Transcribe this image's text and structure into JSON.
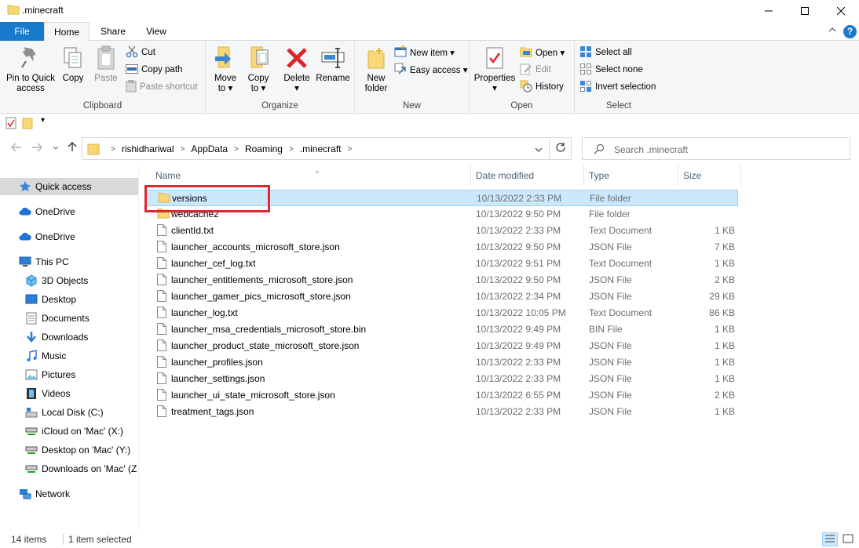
{
  "window": {
    "title": ".minecraft",
    "controls": [
      "minimize",
      "maximize",
      "close"
    ]
  },
  "ribbon_tabs": {
    "file": "File",
    "home": "Home",
    "share": "Share",
    "view": "View"
  },
  "ribbon": {
    "clipboard": {
      "label": "Clipboard",
      "pin_line1": "Pin to Quick",
      "pin_line2": "access",
      "copy": "Copy",
      "paste": "Paste",
      "cut": "Cut",
      "copy_path": "Copy path",
      "paste_shortcut": "Paste shortcut"
    },
    "organize": {
      "label": "Organize",
      "move_line1": "Move",
      "move_line2": "to",
      "copy_line1": "Copy",
      "copy_line2": "to",
      "delete": "Delete",
      "rename": "Rename"
    },
    "new": {
      "label": "New",
      "folder_line1": "New",
      "folder_line2": "folder",
      "new_item": "New item",
      "easy_access": "Easy access"
    },
    "open": {
      "label": "Open",
      "properties": "Properties",
      "open": "Open",
      "edit": "Edit",
      "history": "History"
    },
    "select": {
      "label": "Select",
      "select_all": "Select all",
      "select_none": "Select none",
      "invert": "Invert selection"
    }
  },
  "address": {
    "crumbs": [
      "rishidhariwal",
      "AppData",
      "Roaming",
      ".minecraft"
    ],
    "search_placeholder": "Search .minecraft"
  },
  "nav": {
    "quick_access": "Quick access",
    "onedrive1": "OneDrive",
    "onedrive2": "OneDrive",
    "this_pc": "This PC",
    "objects3d": "3D Objects",
    "desktop": "Desktop",
    "documents": "Documents",
    "downloads": "Downloads",
    "music": "Music",
    "pictures": "Pictures",
    "videos": "Videos",
    "local_disk": "Local Disk (C:)",
    "icloud": "iCloud on 'Mac' (X:)",
    "desktop_mac": "Desktop on 'Mac' (Y:)",
    "downloads_mac": "Downloads on 'Mac' (Z",
    "network": "Network"
  },
  "columns": {
    "name": "Name",
    "date": "Date modified",
    "type": "Type",
    "size": "Size"
  },
  "files": [
    {
      "name": "versions",
      "date": "10/13/2022 2:33 PM",
      "type": "File folder",
      "size": "",
      "icon": "folder-icon"
    },
    {
      "name": "webcache2",
      "date": "10/13/2022 9:50 PM",
      "type": "File folder",
      "size": "",
      "icon": "folder-icon"
    },
    {
      "name": "clientId.txt",
      "date": "10/13/2022 2:33 PM",
      "type": "Text Document",
      "size": "1 KB",
      "icon": "file-icon"
    },
    {
      "name": "launcher_accounts_microsoft_store.json",
      "date": "10/13/2022 9:50 PM",
      "type": "JSON File",
      "size": "7 KB",
      "icon": "file-icon"
    },
    {
      "name": "launcher_cef_log.txt",
      "date": "10/13/2022 9:51 PM",
      "type": "Text Document",
      "size": "1 KB",
      "icon": "file-icon"
    },
    {
      "name": "launcher_entitlements_microsoft_store.json",
      "date": "10/13/2022 9:50 PM",
      "type": "JSON File",
      "size": "2 KB",
      "icon": "file-icon"
    },
    {
      "name": "launcher_gamer_pics_microsoft_store.json",
      "date": "10/13/2022 2:34 PM",
      "type": "JSON File",
      "size": "29 KB",
      "icon": "file-icon"
    },
    {
      "name": "launcher_log.txt",
      "date": "10/13/2022 10:05 PM",
      "type": "Text Document",
      "size": "86 KB",
      "icon": "file-icon"
    },
    {
      "name": "launcher_msa_credentials_microsoft_store.bin",
      "date": "10/13/2022 9:49 PM",
      "type": "BIN File",
      "size": "1 KB",
      "icon": "file-icon"
    },
    {
      "name": "launcher_product_state_microsoft_store.json",
      "date": "10/13/2022 9:49 PM",
      "type": "JSON File",
      "size": "1 KB",
      "icon": "file-icon"
    },
    {
      "name": "launcher_profiles.json",
      "date": "10/13/2022 2:33 PM",
      "type": "JSON File",
      "size": "1 KB",
      "icon": "file-icon"
    },
    {
      "name": "launcher_settings.json",
      "date": "10/13/2022 2:33 PM",
      "type": "JSON File",
      "size": "1 KB",
      "icon": "file-icon"
    },
    {
      "name": "launcher_ui_state_microsoft_store.json",
      "date": "10/13/2022 6:55 PM",
      "type": "JSON File",
      "size": "2 KB",
      "icon": "file-icon"
    },
    {
      "name": "treatment_tags.json",
      "date": "10/13/2022 2:33 PM",
      "type": "JSON File",
      "size": "1 KB",
      "icon": "file-icon"
    }
  ],
  "status": {
    "items": "14 items",
    "selected": "1 item selected"
  },
  "colors": {
    "accent": "#1979ca",
    "selection": "#cce8ff",
    "highlight": "#e0282e",
    "folder": "#f8d775"
  }
}
